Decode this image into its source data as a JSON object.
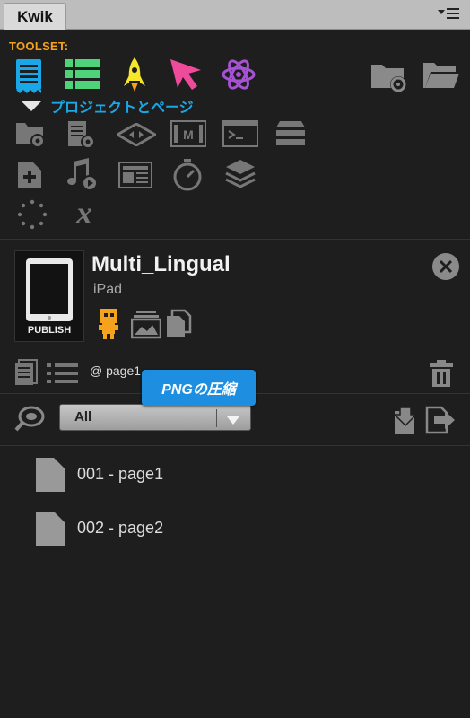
{
  "panel": {
    "tab_title": "Kwik"
  },
  "toolset": {
    "label": "TOOLSET:",
    "project_pages_label": "プロジェクトとページ"
  },
  "project": {
    "name": "Multi_Lingual",
    "device": "iPad",
    "publish_label": "PUBLISH"
  },
  "pages_toolbar": {
    "current_page": "@ page1",
    "tooltip": "PNGの圧縮"
  },
  "filter": {
    "value": "All"
  },
  "pages": [
    {
      "label": "001 - page1"
    },
    {
      "label": "002 - page2"
    }
  ],
  "colors": {
    "accent_orange": "#f5a21d",
    "accent_blue": "#1aa7e8",
    "tooltip_blue": "#1e8ee0",
    "panel_bg": "#1e1e1e"
  }
}
